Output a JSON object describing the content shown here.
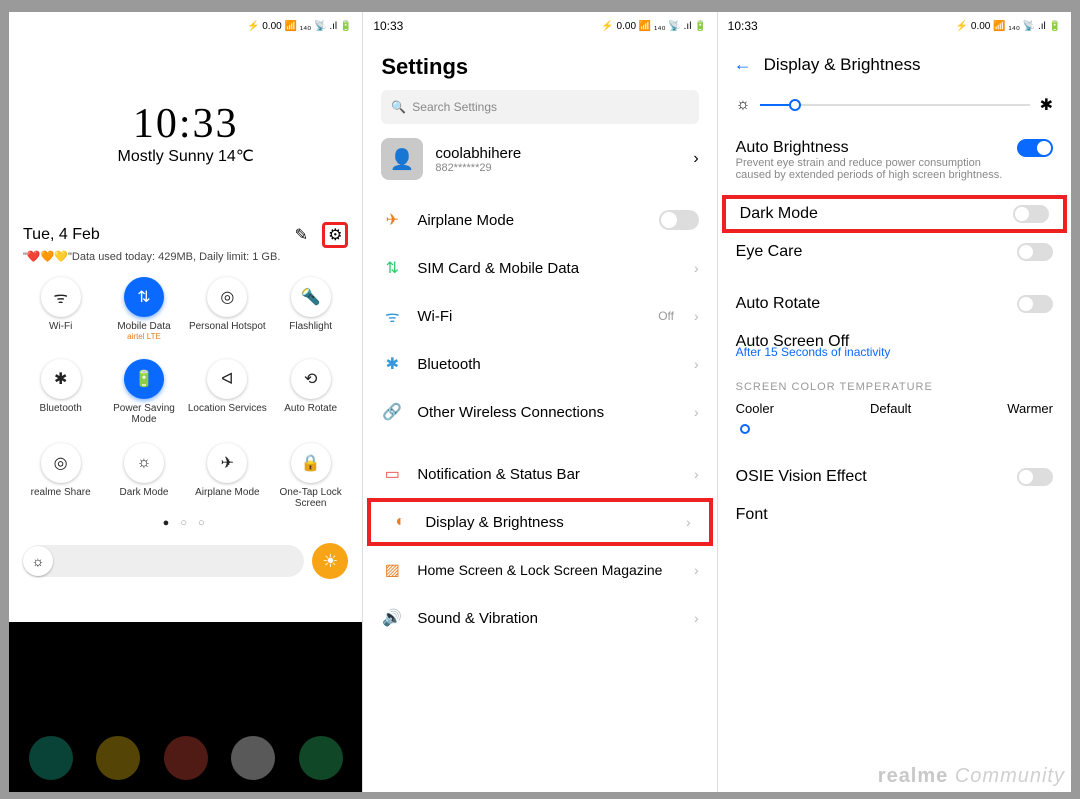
{
  "status": {
    "time": "10:33",
    "icons": "⚡ 0.00 📶 ₁₄₀ 📡 .ıl 🔋"
  },
  "p1": {
    "clock": "10:33",
    "weather": "Mostly Sunny 14℃",
    "date": "Tue, 4 Feb",
    "datastatus": "\"❤️🧡💛\"Data used today: 429MB, Daily limit: 1 GB.",
    "tiles": [
      {
        "icon": "ᯤ",
        "label": "Wi-Fi",
        "on": false
      },
      {
        "icon": "⇅",
        "label": "Mobile Data",
        "on": true,
        "sub": "airtel LTE"
      },
      {
        "icon": "◎",
        "label": "Personal Hotspot",
        "on": false
      },
      {
        "icon": "🔦",
        "label": "Flashlight",
        "on": false
      },
      {
        "icon": "✱",
        "label": "Bluetooth",
        "on": false
      },
      {
        "icon": "🔋",
        "label": "Power Saving Mode",
        "on": true
      },
      {
        "icon": "ᐊ",
        "label": "Location Services",
        "on": false
      },
      {
        "icon": "⟲",
        "label": "Auto Rotate",
        "on": false
      },
      {
        "icon": "◎",
        "label": "realme Share",
        "on": false
      },
      {
        "icon": "☼",
        "label": "Dark Mode",
        "on": false
      },
      {
        "icon": "✈",
        "label": "Airplane Mode",
        "on": false
      },
      {
        "icon": "🔒",
        "label": "One-Tap Lock Screen",
        "on": false
      }
    ]
  },
  "p2": {
    "title": "Settings",
    "search_placeholder": "Search Settings",
    "account": {
      "name": "coolabhihere",
      "phone": "882******29"
    },
    "rows": [
      {
        "icon": "✈",
        "color": "#e67e22",
        "label": "Airplane Mode",
        "type": "toggle",
        "on": false
      },
      {
        "icon": "⇅",
        "color": "#2ecc71",
        "label": "SIM Card & Mobile Data",
        "type": "link"
      },
      {
        "icon": "ᯤ",
        "color": "#3498db",
        "label": "Wi-Fi",
        "type": "link",
        "value": "Off"
      },
      {
        "icon": "✱",
        "color": "#3498db",
        "label": "Bluetooth",
        "type": "link"
      },
      {
        "icon": "🔗",
        "color": "#3498db",
        "label": "Other Wireless Connections",
        "type": "link"
      },
      {
        "icon": "▭",
        "color": "#e74c3c",
        "label": "Notification & Status Bar",
        "type": "link",
        "gap": true
      },
      {
        "icon": "◐",
        "color": "#e67e22",
        "label": "Display & Brightness",
        "type": "link",
        "hl": true
      },
      {
        "icon": "▨",
        "color": "#e67e22",
        "label": "Home Screen & Lock Screen Magazine",
        "type": "link",
        "sub2": true
      },
      {
        "icon": "🔊",
        "color": "#2ecc71",
        "label": "Sound & Vibration",
        "type": "link"
      }
    ]
  },
  "p3": {
    "header": "Display & Brightness",
    "auto": {
      "title": "Auto Brightness",
      "desc": "Prevent eye strain and reduce power consumption caused by extended periods of high screen brightness."
    },
    "rows": [
      {
        "label": "Dark Mode",
        "hl": true,
        "on": false
      },
      {
        "label": "Eye Care",
        "on": false
      },
      {
        "label": "Auto Rotate",
        "on": false,
        "gap": true
      }
    ],
    "aso": {
      "label": "Auto Screen Off",
      "sub": "After 15 Seconds of inactivity"
    },
    "sct": "SCREEN COLOR TEMPERATURE",
    "temp": [
      "Cooler",
      "Default",
      "Warmer"
    ],
    "osie": "OSIE Vision Effect",
    "font": "Font",
    "wm": "realme Community"
  }
}
